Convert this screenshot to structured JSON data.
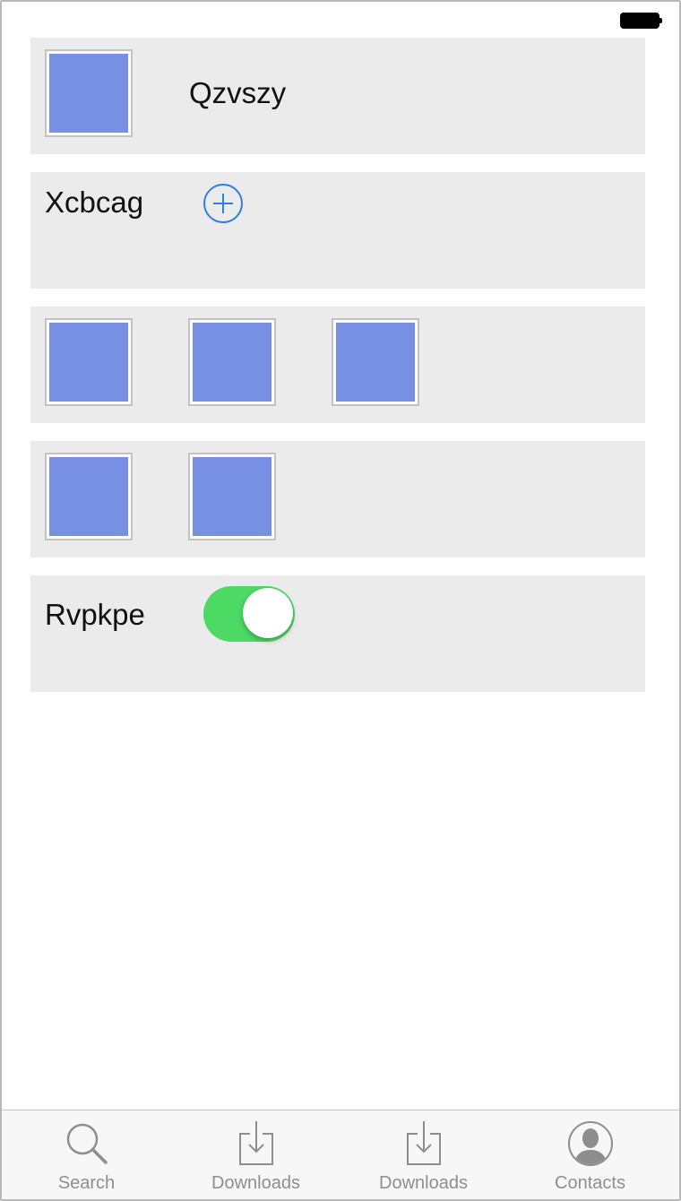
{
  "status_bar": {
    "battery_icon": "battery-full-icon"
  },
  "rows": [
    {
      "type": "image-label",
      "label": "Qzvszy"
    },
    {
      "type": "label-add",
      "label": "Xcbcag",
      "add_icon": "plus-circle-icon"
    },
    {
      "type": "images",
      "count": 3
    },
    {
      "type": "images",
      "count": 2
    },
    {
      "type": "label-toggle",
      "label": "Rvpkpe",
      "toggle_on": true
    }
  ],
  "tab_bar": {
    "tabs": [
      {
        "label": "Search",
        "icon": "search-icon"
      },
      {
        "label": "Downloads",
        "icon": "download-icon"
      },
      {
        "label": "Downloads",
        "icon": "download-icon"
      },
      {
        "label": "Contacts",
        "icon": "contact-icon"
      }
    ]
  },
  "colors": {
    "row_bg": "#ebebeb",
    "image_fill": "#7890e4",
    "accent_blue": "#2f7fe2",
    "toggle_green": "#4cd964",
    "tab_label": "#8e8e8e"
  }
}
